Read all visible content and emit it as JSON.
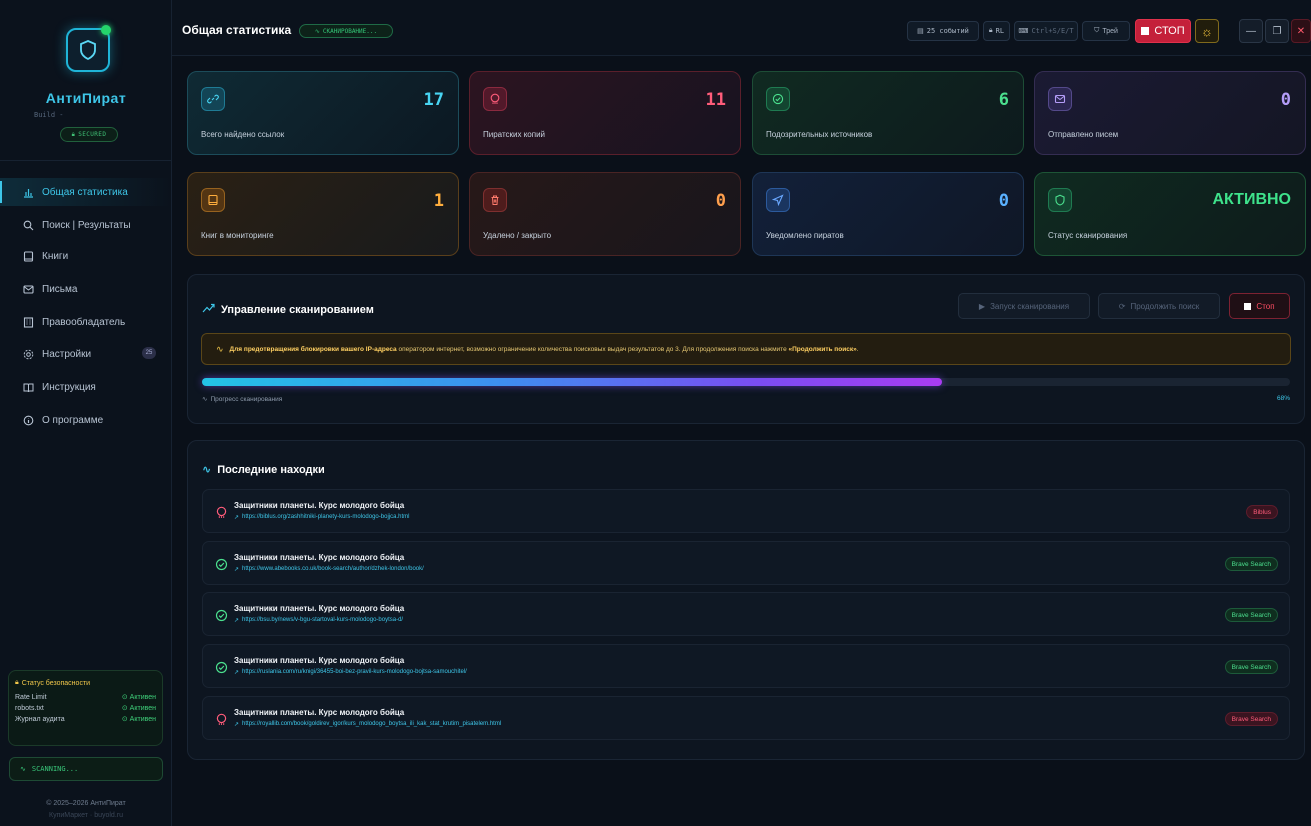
{
  "sidebar": {
    "app_name": "АнтиПират",
    "build": "Build -",
    "secured": "SECURED",
    "nav": [
      {
        "label": "Общая статистика",
        "icon": "bar-chart-icon",
        "active": true
      },
      {
        "label": "Поиск | Результаты",
        "icon": "search-icon"
      },
      {
        "label": "Книги",
        "icon": "book-icon"
      },
      {
        "label": "Письма",
        "icon": "mail-icon"
      },
      {
        "label": "Правообладатель",
        "icon": "building-icon"
      },
      {
        "label": "Настройки",
        "icon": "gear-icon",
        "badge": "25"
      },
      {
        "label": "Инструкция",
        "icon": "open-book-icon"
      },
      {
        "label": "О программе",
        "icon": "info-icon"
      }
    ],
    "security": {
      "title": "Статус безопасности",
      "rows": [
        {
          "name": "Rate Limit",
          "status": "Активен"
        },
        {
          "name": "robots.txt",
          "status": "Активен"
        },
        {
          "name": "Журнал аудита",
          "status": "Активен"
        }
      ]
    },
    "scanning": "SCANNING...",
    "copyright": "© 2025–2026 АнтиПират",
    "copyright2": "КупиМаркет · buyold.ru"
  },
  "topbar": {
    "title": "Общая статистика",
    "scan_status": "СКАНИРОВАНИЕ...",
    "events": "25 событий",
    "rl": "RL",
    "hotkeys": "Ctrl+S/E/T",
    "tray": "Трей",
    "stop": "СТОП"
  },
  "cards": [
    {
      "value": "17",
      "label": "Всего найдено ссылок",
      "icon": "link-icon"
    },
    {
      "value": "11",
      "label": "Пиратских копий",
      "icon": "pirate-icon"
    },
    {
      "value": "6",
      "label": "Подозрительных источников",
      "icon": "check-circle-icon"
    },
    {
      "value": "0",
      "label": "Отправлено писем",
      "icon": "mail-icon"
    },
    {
      "value": "1",
      "label": "Книг в мониторинге",
      "icon": "book-icon"
    },
    {
      "value": "0",
      "label": "Удалено / закрыто",
      "icon": "trash-icon"
    },
    {
      "value": "0",
      "label": "Уведомлено пиратов",
      "icon": "send-icon"
    },
    {
      "value": "АКТИВНО",
      "label": "Статус сканирования",
      "icon": "shield-icon"
    }
  ],
  "scan_panel": {
    "title": "Управление сканированием",
    "start": "Запуск сканирования",
    "continue": "Продолжить поиск",
    "stop": "Стоп",
    "warning_bold1": "Для предотвращения блокировки вашего IP-адреса",
    "warning_text": " оператором интернет, возможно ограничение количества поисковых выдач результатов до 3. Для продолжения поиска нажмите ",
    "warning_bold2": "«Продолжить поиск»",
    "warning_end": ".",
    "progress_label": "Прогресс сканирования",
    "progress_pct": "68%",
    "progress_value": 0.68
  },
  "findings": {
    "title": "Последние находки",
    "items": [
      {
        "title": "Защитники планеты. Курс молодого бойца",
        "url": "https://biblus.org/zashhitniki-planety-kurs-molodogo-bojjca.html",
        "source": "Biblus",
        "kind": "pirate"
      },
      {
        "title": "Защитники планеты. Курс молодого бойца",
        "url": "https://www.abebooks.co.uk/book-search/author/dzhek-london/book/",
        "source": "Brave Search",
        "kind": "ok"
      },
      {
        "title": "Защитники планеты. Курс молодого бойца",
        "url": "https://bsu.by/news/v-bgu-startoval-kurs-molodogo-boytsa-d/",
        "source": "Brave Search",
        "kind": "ok"
      },
      {
        "title": "Защитники планеты. Курс молодого бойца",
        "url": "https://ruslania.com/ru/knigi/36455-boi-bez-pravil-kurs-molodogo-bojtsa-samouchitel/",
        "source": "Brave Search",
        "kind": "ok"
      },
      {
        "title": "Защитники планеты. Курс молодого бойца",
        "url": "https://royallib.com/book/goldirev_igor/kurs_molodogo_boytsa_ili_kak_stat_krutim_pisatelem.html",
        "source": "Brave Search",
        "kind": "pirate"
      }
    ]
  }
}
